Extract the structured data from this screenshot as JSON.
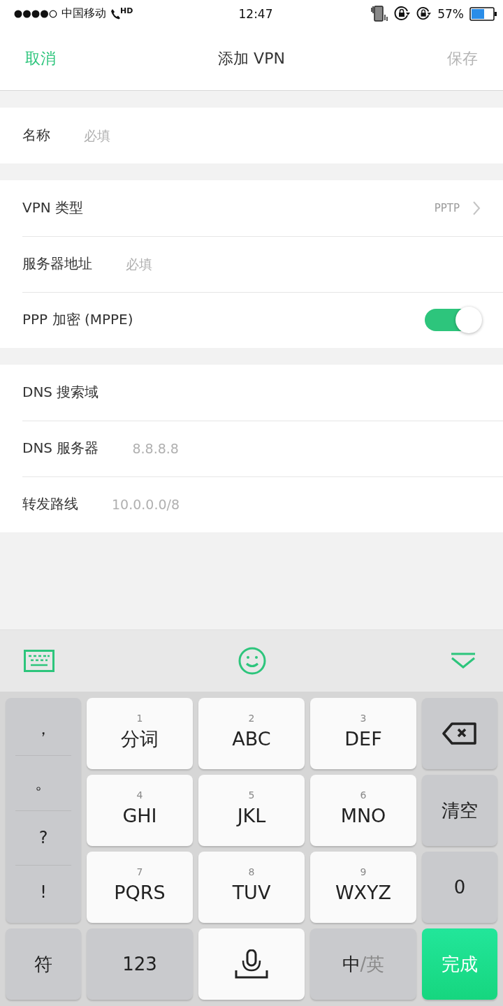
{
  "status_bar": {
    "carrier": "中国移动",
    "call_badge": "HD",
    "time": "12:47",
    "battery": "57%"
  },
  "nav": {
    "cancel": "取消",
    "title": "添加 VPN",
    "save": "保存",
    "save_disabled": true
  },
  "sections": [
    [
      {
        "kind": "field",
        "label": "名称",
        "placeholder": "必填"
      }
    ],
    [
      {
        "kind": "select",
        "label": "VPN 类型",
        "value": "PPTP"
      },
      {
        "kind": "field",
        "label": "服务器地址",
        "placeholder": "必填"
      },
      {
        "kind": "toggle",
        "label": "PPP 加密 (MPPE)",
        "on": true
      }
    ],
    [
      {
        "kind": "field",
        "label": "DNS 搜索域"
      },
      {
        "kind": "field",
        "label": "DNS 服务器",
        "placeholder": "8.8.8.8"
      },
      {
        "kind": "field",
        "label": "转发路线",
        "placeholder": "10.0.0.0/8"
      }
    ]
  ],
  "keyboard": {
    "punctuation": [
      "，",
      "。",
      "?",
      "!"
    ],
    "keys": [
      {
        "kind": "letter",
        "number": "1",
        "label": "分词"
      },
      {
        "kind": "letter",
        "number": "2",
        "label": "ABC"
      },
      {
        "kind": "letter",
        "number": "3",
        "label": "DEF"
      },
      {
        "kind": "backspace"
      },
      {
        "kind": "letter",
        "number": "4",
        "label": "GHI"
      },
      {
        "kind": "letter",
        "number": "5",
        "label": "JKL"
      },
      {
        "kind": "letter",
        "number": "6",
        "label": "MNO"
      },
      {
        "kind": "function",
        "label": "清空"
      },
      {
        "kind": "letter",
        "number": "7",
        "label": "PQRS"
      },
      {
        "kind": "letter",
        "number": "8",
        "label": "TUV"
      },
      {
        "kind": "letter",
        "number": "9",
        "label": "WXYZ"
      },
      {
        "kind": "function",
        "label": "0"
      },
      {
        "kind": "function",
        "label": "符"
      },
      {
        "kind": "function",
        "label": "123"
      },
      {
        "kind": "mic"
      },
      {
        "kind": "lang",
        "label": "中",
        "alt": "/英"
      },
      {
        "kind": "done",
        "label": "完成"
      }
    ]
  }
}
